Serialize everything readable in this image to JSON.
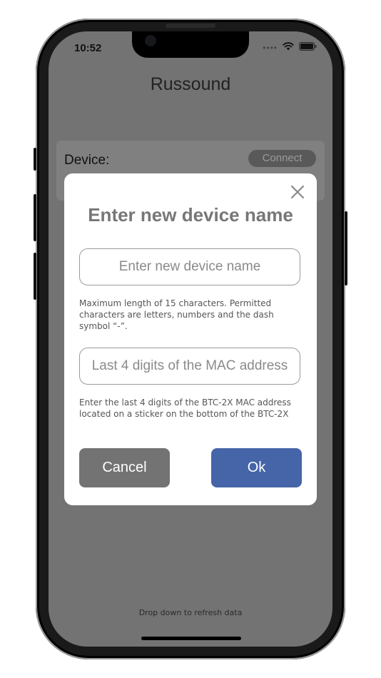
{
  "status_bar": {
    "time": "10:52",
    "signal": "••••"
  },
  "app": {
    "title": "Russound",
    "device_label": "Device:",
    "connect_label": "Connect",
    "footer_hint": "Drop down to refresh data"
  },
  "dialog": {
    "title": "Enter new device name",
    "name_field": {
      "value": "",
      "placeholder": "Enter new device name"
    },
    "name_help": "Maximum length of 15 characters. Permitted characters are letters, numbers and the dash symbol “-”.",
    "mac_field": {
      "value": "",
      "placeholder": "Last 4 digits of the MAC address"
    },
    "mac_help": "Enter the last 4 digits of the BTC-2X MAC address located on a sticker on the bottom of the BTC-2X",
    "cancel_label": "Cancel",
    "ok_label": "Ok"
  },
  "icons": {
    "close": "close-icon",
    "wifi": "wifi-icon",
    "battery": "battery-icon"
  },
  "colors": {
    "ok_button": "#4565a8",
    "cancel_button": "#737373",
    "overlay": "#737373",
    "dialog_title": "#777777"
  }
}
